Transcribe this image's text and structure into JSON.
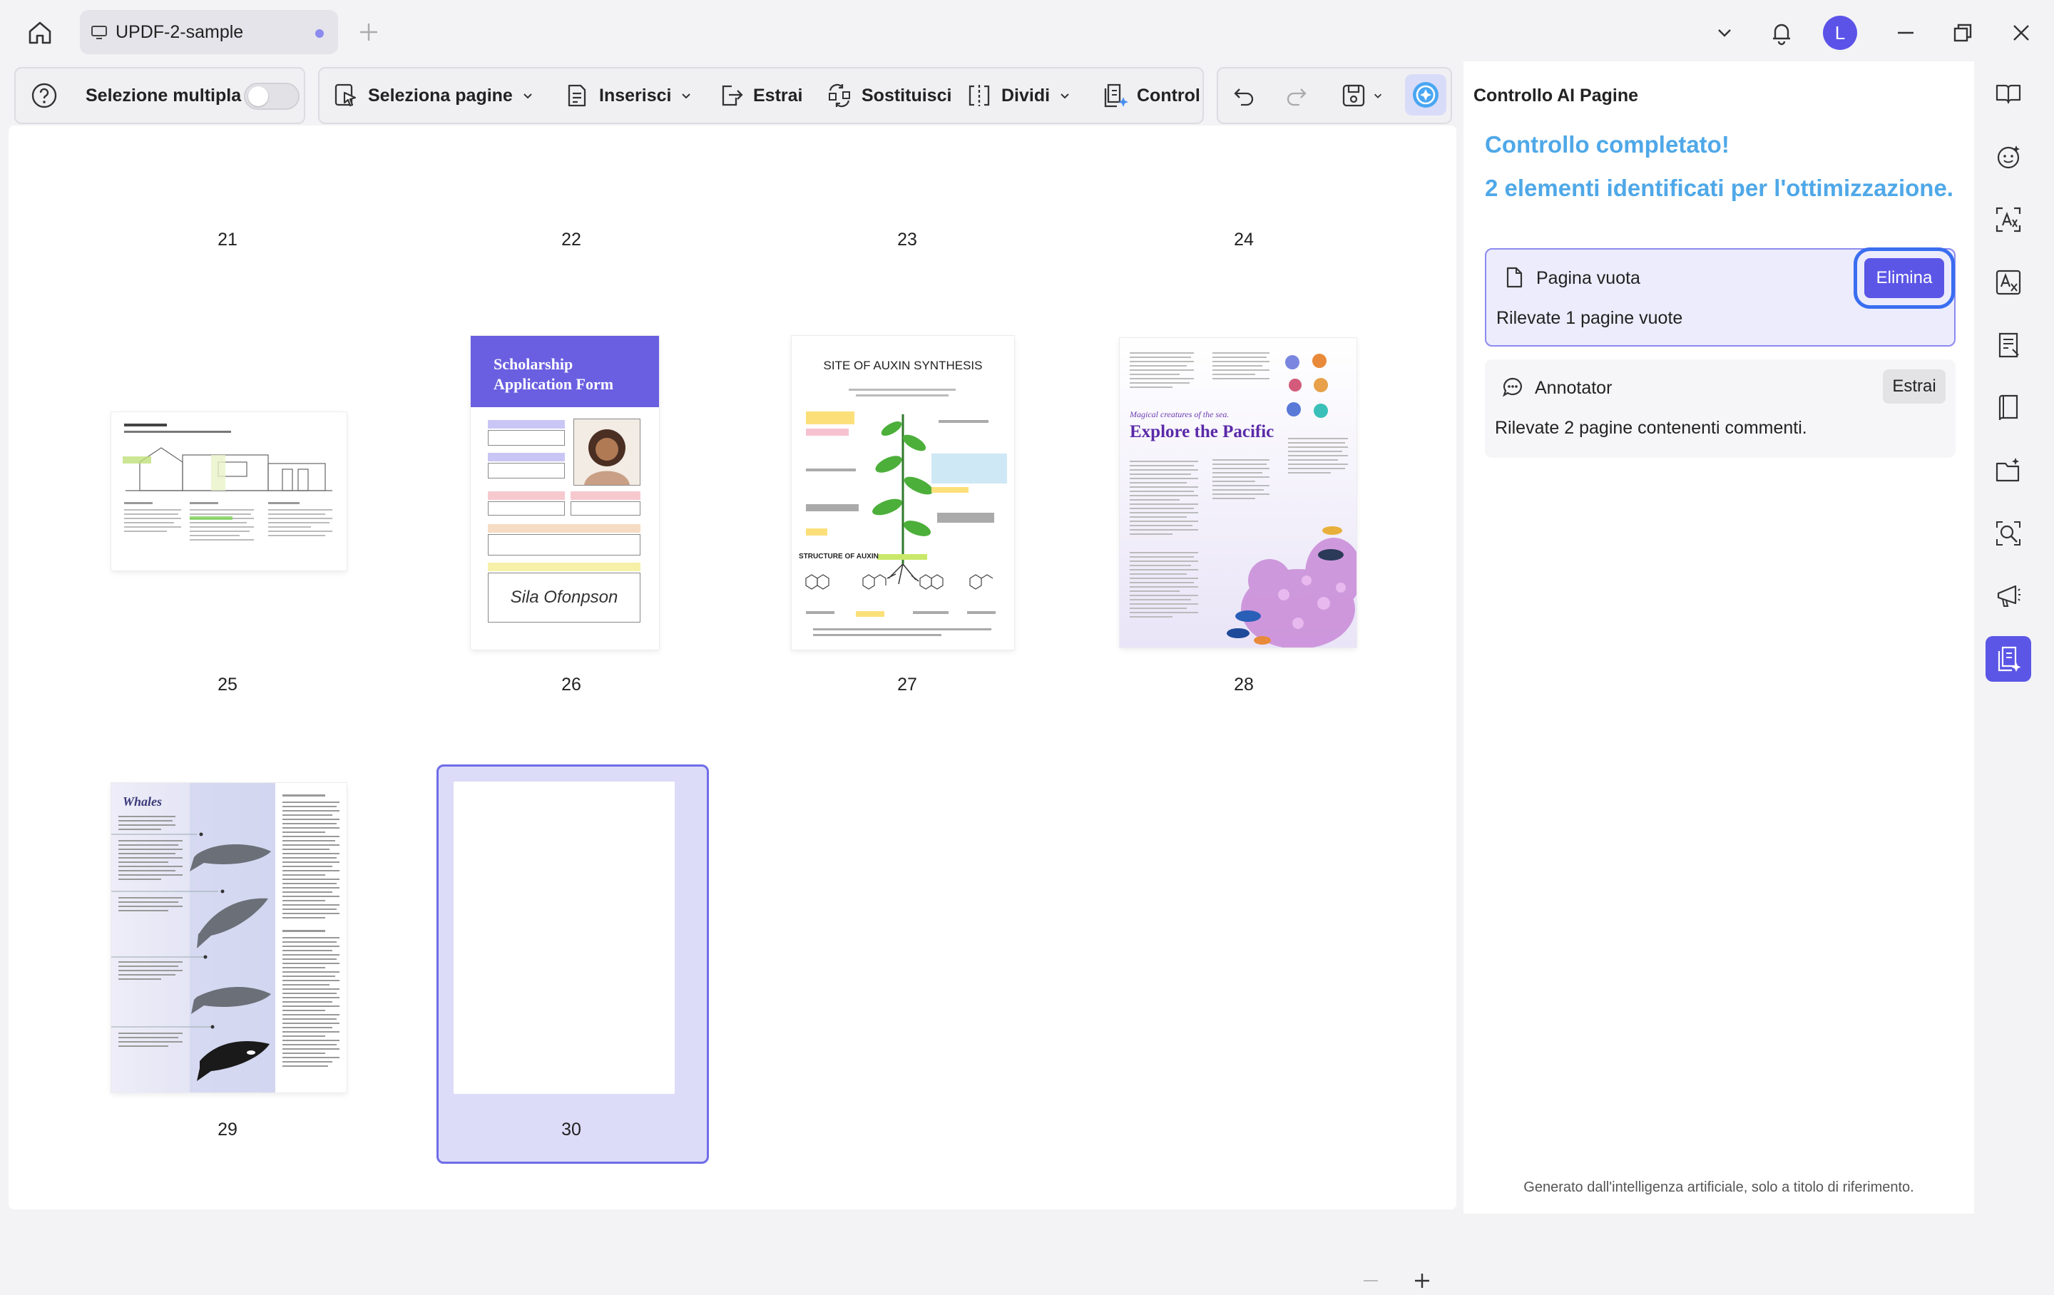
{
  "tab": {
    "title": "UPDF-2-sample"
  },
  "avatar": {
    "initial": "L"
  },
  "toolbar": {
    "multi_select_label": "Selezione multipla",
    "select_pages_label": "Seleziona pagine",
    "insert_label": "Inserisci",
    "extract_label": "Estrai",
    "replace_label": "Sostituisci",
    "split_label": "Dividi",
    "control_label": "Control"
  },
  "pages": {
    "row1": [
      "21",
      "22",
      "23",
      "24"
    ],
    "row2": [
      "25",
      "26",
      "27",
      "28"
    ],
    "row3": [
      "29",
      "30"
    ],
    "selected": "30"
  },
  "thumbs": {
    "p26_title": "Scholarship Application Form",
    "p26_signature": "Sila Ofonpson",
    "p27_title": "SITE OF AUXIN SYNTHESIS",
    "p27_structure": "STRUCTURE OF AUXIN",
    "p28_kicker": "Magical creatures of the sea.",
    "p28_title": "Explore the Pacific",
    "p29_title": "Whales"
  },
  "panel": {
    "title": "Controllo AI Pagine",
    "completed": "Controllo completato!",
    "found": "2 elementi identificati per l'ottimizzazione.",
    "items": [
      {
        "title": "Pagina vuota",
        "desc": "Rilevate 1 pagine vuote",
        "action": "Elimina"
      },
      {
        "title": "Annotator",
        "desc": "Rilevate 2 pagine contenenti commenti.",
        "action": "Estrai"
      }
    ],
    "disclaimer": "Generato dall'intelligenza artificiale, solo a titolo di riferimento."
  },
  "colors": {
    "accent": "#5b56e6",
    "heading": "#4fa8e8",
    "selection": "#dcdcf8"
  }
}
